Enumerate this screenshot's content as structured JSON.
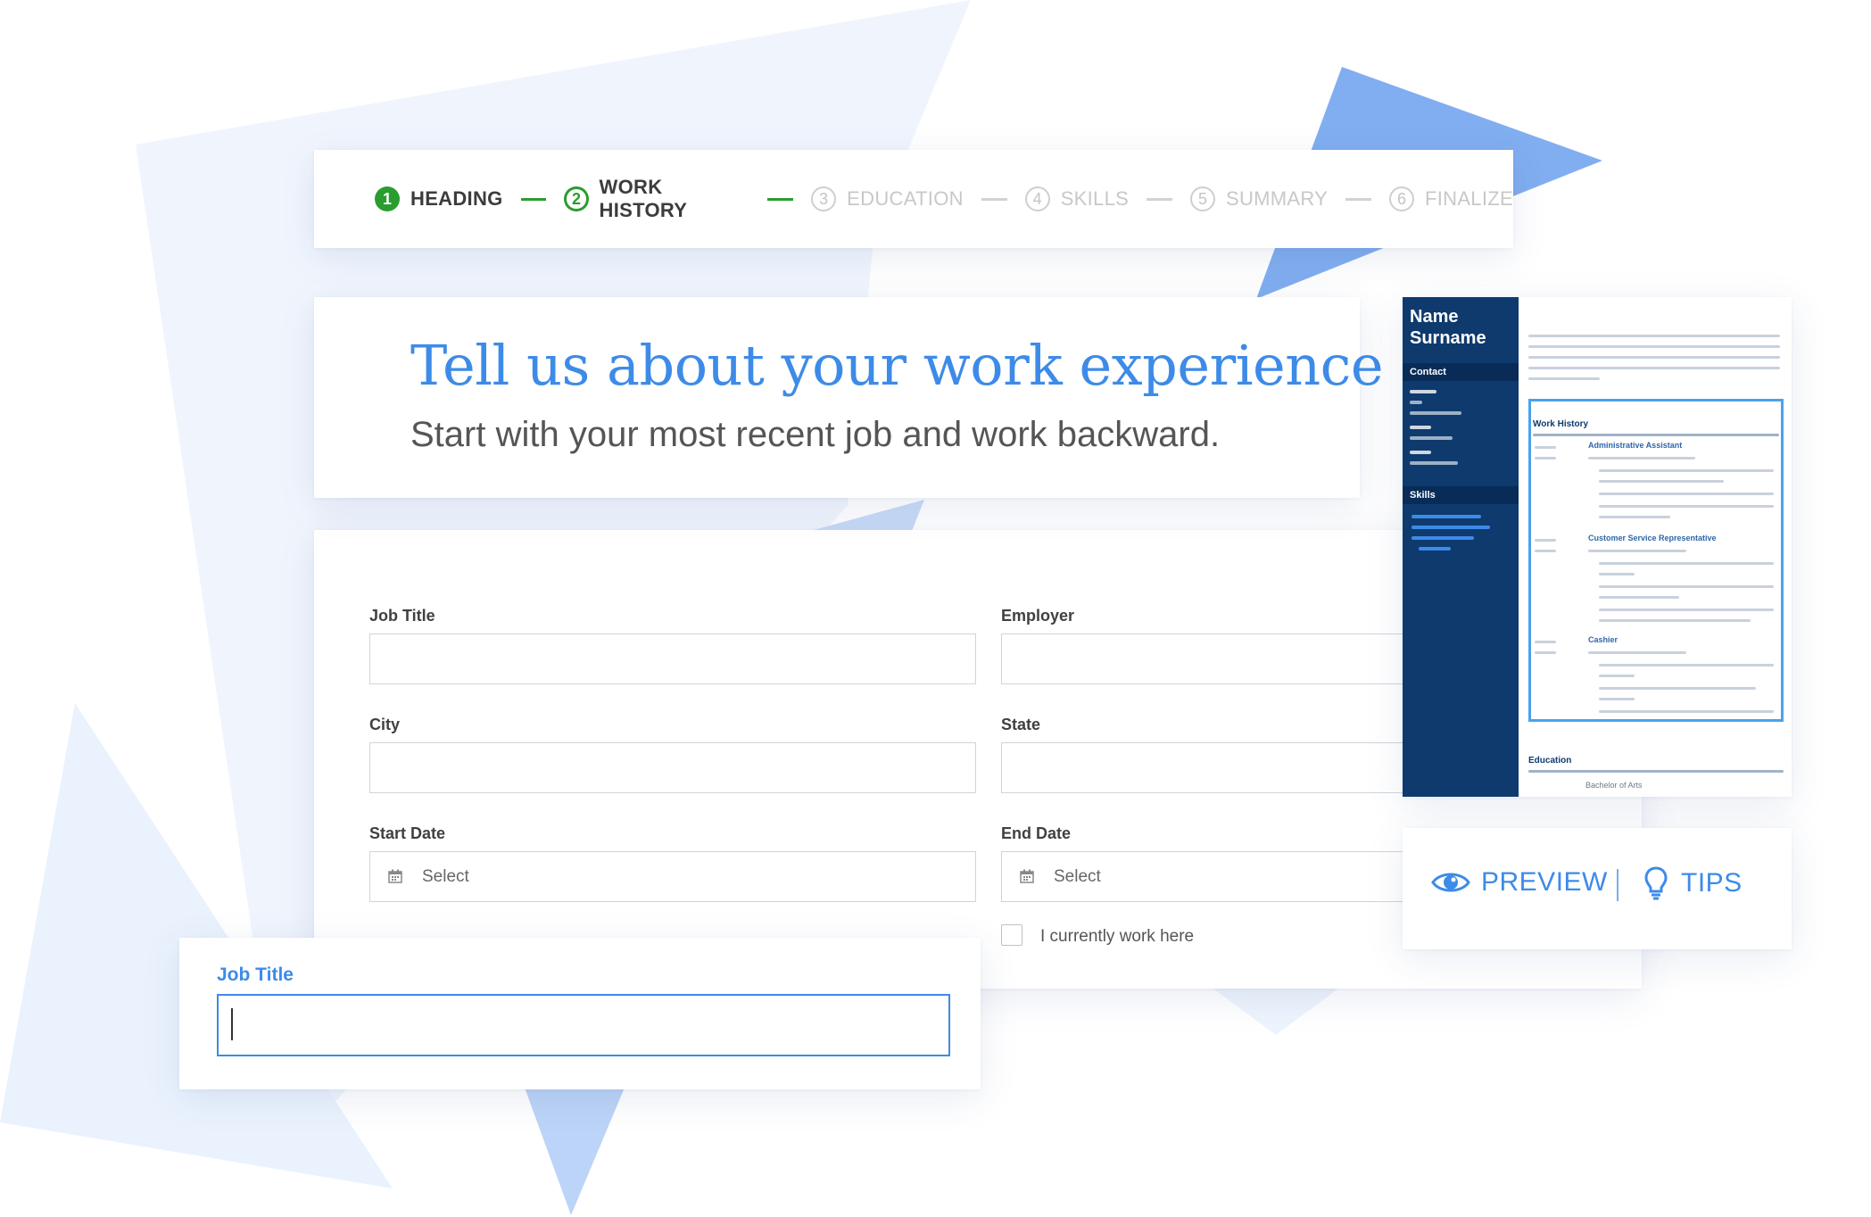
{
  "stepper": {
    "steps": [
      {
        "num": "1",
        "label": "HEADING",
        "state": "done"
      },
      {
        "num": "2",
        "label": "WORK HISTORY",
        "state": "active"
      },
      {
        "num": "3",
        "label": "EDUCATION",
        "state": "pending"
      },
      {
        "num": "4",
        "label": "SKILLS",
        "state": "pending"
      },
      {
        "num": "5",
        "label": "SUMMARY",
        "state": "pending"
      },
      {
        "num": "6",
        "label": "FINALIZE",
        "state": "pending"
      }
    ]
  },
  "heading": {
    "title": "Tell us about your work experience",
    "subtitle": "Start with your most recent job and work backward."
  },
  "form": {
    "job_title_label": "Job Title",
    "employer_label": "Employer",
    "city_label": "City",
    "state_label": "State",
    "start_date_label": "Start Date",
    "start_date_placeholder": "Select",
    "end_date_label": "End Date",
    "end_date_placeholder": "Select",
    "current_label": "I currently work here"
  },
  "focused_field": {
    "label": "Job Title",
    "value": ""
  },
  "resume": {
    "name_line1": "Name",
    "name_line2": "Surname",
    "contact_heading": "Contact",
    "skills_heading": "Skills",
    "work_history_heading": "Work History",
    "jobs": [
      "Administrative Assistant",
      "Customer Service Representative",
      "Cashier"
    ],
    "education_heading": "Education",
    "education_degree": "Bachelor of Arts"
  },
  "actions": {
    "preview_label": "PREVIEW",
    "tips_label": "TIPS"
  },
  "colors": {
    "accent": "#3d8be8",
    "success": "#2a9d2f",
    "resume_sidebar": "#0e3a6e"
  }
}
